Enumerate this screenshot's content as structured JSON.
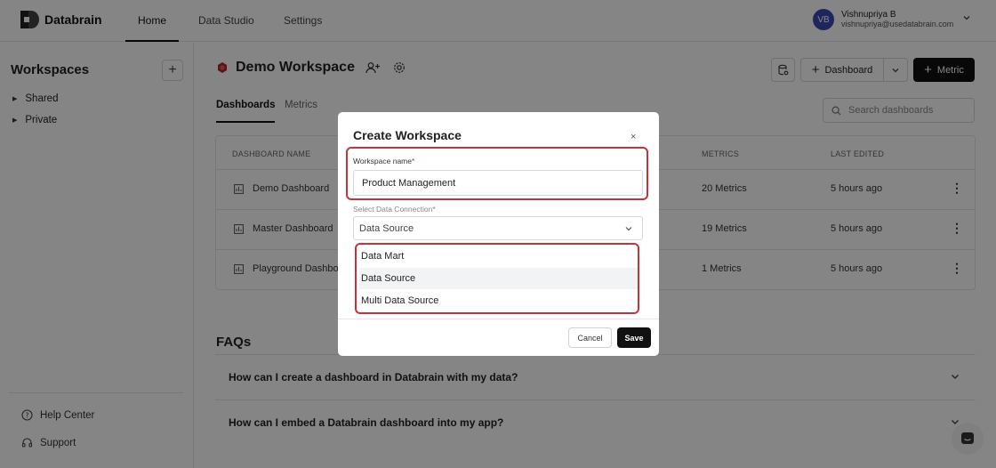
{
  "app": {
    "name": "Databrain"
  },
  "topnav": {
    "tabs": [
      {
        "label": "Home",
        "active": true
      },
      {
        "label": "Data Studio",
        "active": false
      },
      {
        "label": "Settings",
        "active": false
      }
    ],
    "user": {
      "initials": "VB",
      "name": "Vishnupriya B",
      "email": "vishnupriya@usedatabrain.com"
    }
  },
  "sidebar": {
    "title": "Workspaces",
    "add_icon": "plus-icon",
    "items": [
      {
        "label": "Shared",
        "icon": "caret-right-icon"
      },
      {
        "label": "Private",
        "icon": "caret-right-icon"
      }
    ],
    "footer": [
      {
        "label": "Help Center",
        "icon": "help-circle-icon"
      },
      {
        "label": "Support",
        "icon": "headset-icon"
      }
    ]
  },
  "workspace": {
    "name": "Demo Workspace",
    "actions": {
      "dashboard_label": "Dashboard",
      "metric_label": "Metric"
    },
    "tabs": [
      {
        "label": "Dashboards",
        "active": true
      },
      {
        "label": "Metrics",
        "active": false
      }
    ],
    "search_placeholder": "Search dashboards"
  },
  "table": {
    "columns": [
      "DASHBOARD NAME",
      "METRICS",
      "LAST EDITED"
    ],
    "rows": [
      {
        "name": "Demo Dashboard",
        "metrics": "20 Metrics",
        "edited": "5 hours ago"
      },
      {
        "name": "Master Dashboard",
        "metrics": "19 Metrics",
        "edited": "5 hours ago"
      },
      {
        "name": "Playground Dashbo",
        "metrics": "1 Metrics",
        "edited": "5 hours ago"
      }
    ]
  },
  "faqs": {
    "title": "FAQs",
    "items": [
      "How can I create a dashboard in Databrain with my data?",
      "How can I embed a Databrain dashboard into my app?"
    ]
  },
  "modal": {
    "title": "Create Workspace",
    "close": "×",
    "name_label": "Workspace name",
    "name_value": "Product Management",
    "connection_label": "Select Data Connection",
    "required_mark": "*",
    "connection_value": "Data Source",
    "options": [
      "Data Mart",
      "Data Source",
      "Multi Data Source"
    ],
    "hovered_option": "Data Source",
    "cancel_label": "Cancel",
    "save_label": "Save"
  },
  "colors": {
    "highlight": "#c8333a",
    "primary": "#111111",
    "avatar": "#3b4bb3"
  }
}
